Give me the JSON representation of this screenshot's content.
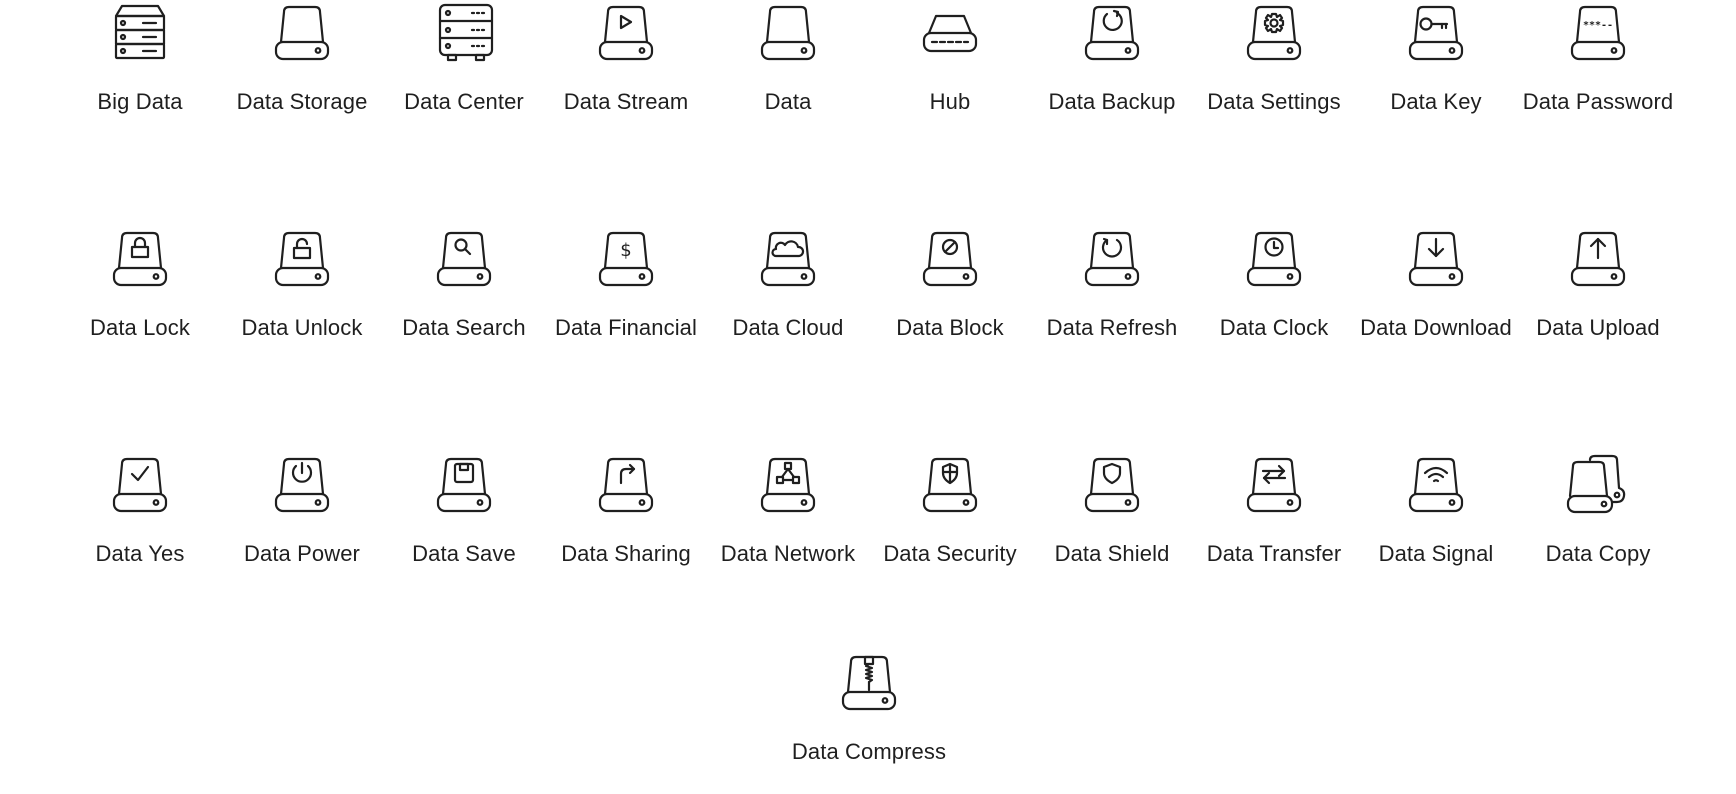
{
  "icons": [
    {
      "label": "Big Data",
      "icon": "big-data-icon"
    },
    {
      "label": "Data Storage",
      "icon": "data-storage-icon"
    },
    {
      "label": "Data Center",
      "icon": "data-center-icon"
    },
    {
      "label": "Data Stream",
      "icon": "data-stream-icon"
    },
    {
      "label": "Data",
      "icon": "data-icon"
    },
    {
      "label": "Hub",
      "icon": "hub-icon"
    },
    {
      "label": "Data Backup",
      "icon": "data-backup-icon"
    },
    {
      "label": "Data Settings",
      "icon": "data-settings-icon"
    },
    {
      "label": "Data Key",
      "icon": "data-key-icon"
    },
    {
      "label": "Data Password",
      "icon": "data-password-icon"
    },
    {
      "label": "Data Lock",
      "icon": "data-lock-icon"
    },
    {
      "label": "Data Unlock",
      "icon": "data-unlock-icon"
    },
    {
      "label": "Data Search",
      "icon": "data-search-icon"
    },
    {
      "label": "Data Financial",
      "icon": "data-financial-icon"
    },
    {
      "label": "Data Cloud",
      "icon": "data-cloud-icon"
    },
    {
      "label": "Data Block",
      "icon": "data-block-icon"
    },
    {
      "label": "Data Refresh",
      "icon": "data-refresh-icon"
    },
    {
      "label": "Data Clock",
      "icon": "data-clock-icon"
    },
    {
      "label": "Data Download",
      "icon": "data-download-icon"
    },
    {
      "label": "Data Upload",
      "icon": "data-upload-icon"
    },
    {
      "label": "Data Yes",
      "icon": "data-yes-icon"
    },
    {
      "label": "Data Power",
      "icon": "data-power-icon"
    },
    {
      "label": "Data Save",
      "icon": "data-save-icon"
    },
    {
      "label": "Data Sharing",
      "icon": "data-sharing-icon"
    },
    {
      "label": "Data Network",
      "icon": "data-network-icon"
    },
    {
      "label": "Data Security",
      "icon": "data-security-icon"
    },
    {
      "label": "Data Shield",
      "icon": "data-shield-icon"
    },
    {
      "label": "Data Transfer",
      "icon": "data-transfer-icon"
    },
    {
      "label": "Data Signal",
      "icon": "data-signal-icon"
    },
    {
      "label": "Data Copy",
      "icon": "data-copy-icon"
    },
    {
      "label": "Data Compress",
      "icon": "data-compress-icon"
    }
  ],
  "colors": {
    "stroke": "#1f1f1f",
    "background": "#ffffff"
  }
}
